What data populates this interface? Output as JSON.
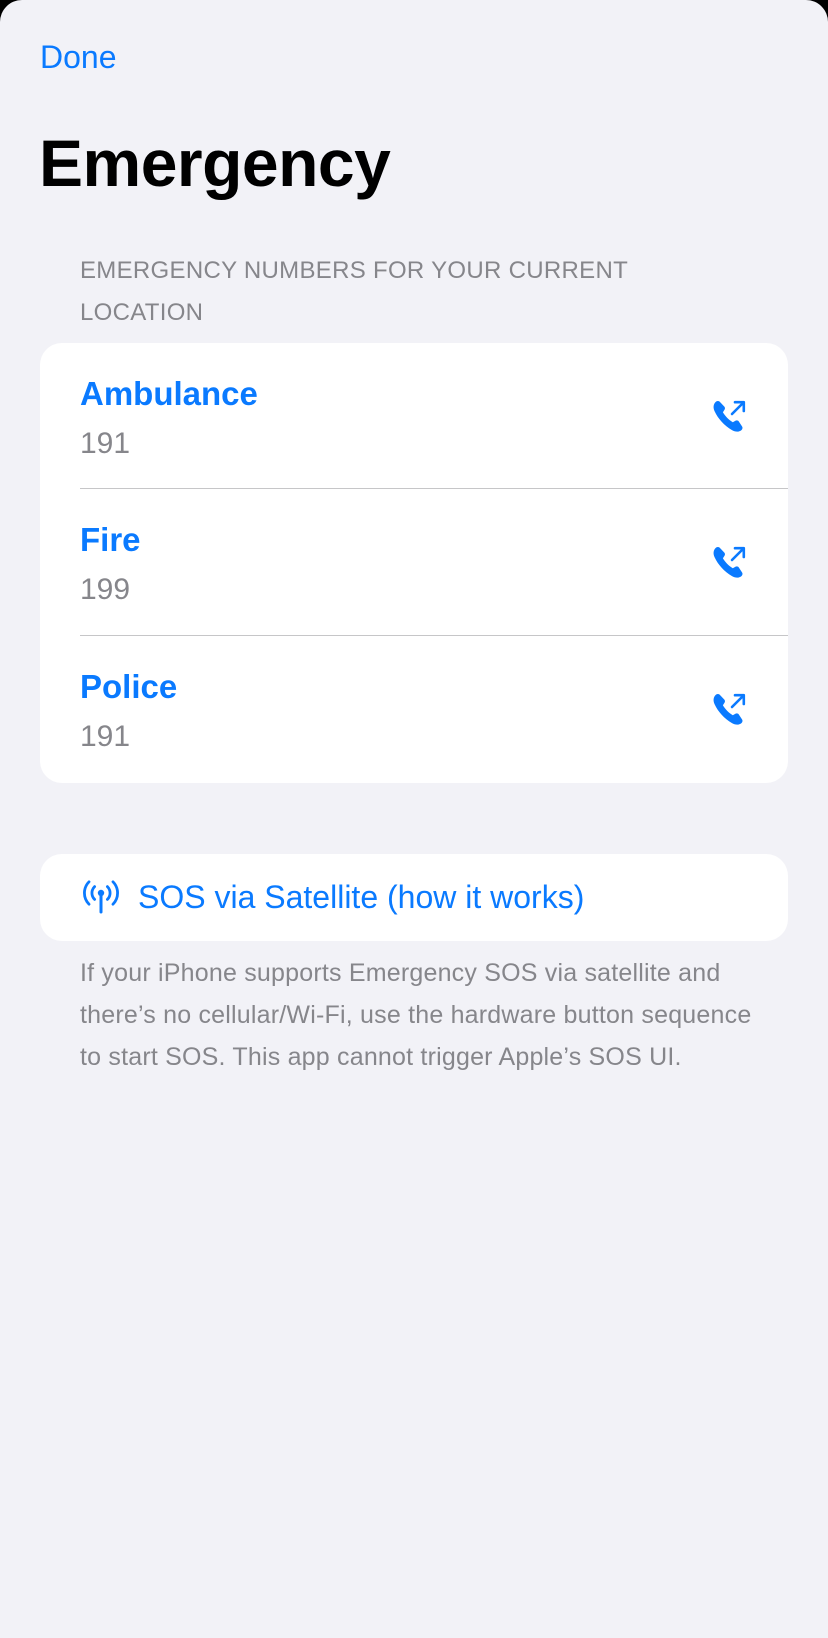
{
  "header": {
    "done_label": "Done",
    "title": "Emergency"
  },
  "numbers_section": {
    "header": "EMERGENCY NUMBERS FOR YOUR CURRENT LOCATION",
    "items": [
      {
        "name": "Ambulance",
        "number": "191",
        "icon": "phone-outgoing-icon"
      },
      {
        "name": "Fire",
        "number": "199",
        "icon": "phone-outgoing-icon"
      },
      {
        "name": "Police",
        "number": "191",
        "icon": "phone-outgoing-icon"
      }
    ]
  },
  "sos": {
    "icon": "antenna-signal-icon",
    "label": "SOS via Satellite (how it works)",
    "note": "If your iPhone supports Emergency SOS via satellite and there’s no cellular/Wi-Fi, use the hardware button sequence to start SOS. This app cannot trigger Apple’s SOS UI."
  },
  "colors": {
    "accent": "#0a7aff",
    "background": "#f2f2f7",
    "card": "#ffffff",
    "secondary_text": "#86868b",
    "separator": "#c6c6c8"
  }
}
